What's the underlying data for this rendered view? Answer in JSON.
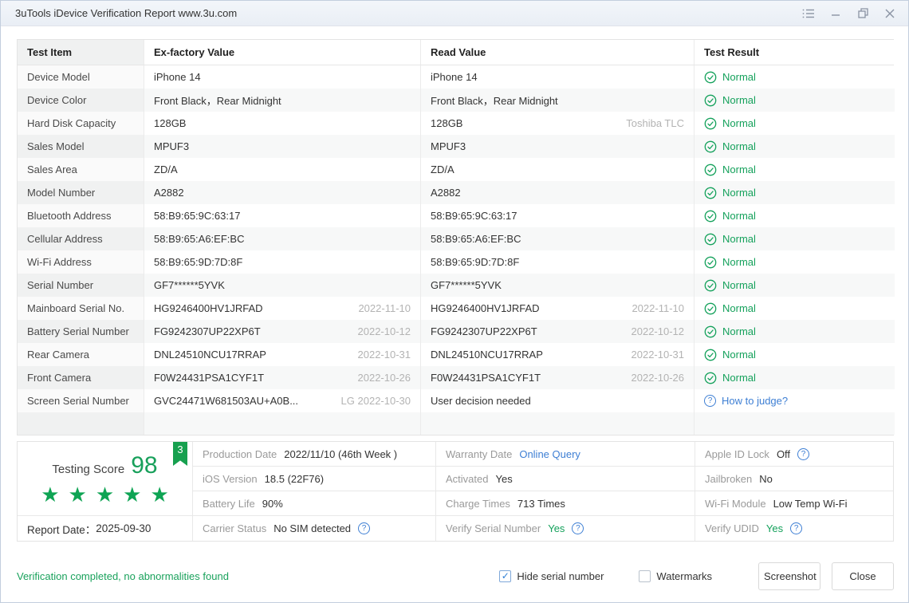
{
  "window": {
    "title": "3uTools iDevice Verification Report www.3u.com"
  },
  "colors": {
    "green": "#14a15b",
    "blue": "#3e7fd4",
    "badge_green": "#17a04f"
  },
  "icons": {
    "check": "✓",
    "question": "?",
    "star": "★"
  },
  "table": {
    "headers": [
      "Test Item",
      "Ex-factory Value",
      "Read Value",
      "Test Result"
    ],
    "rows": [
      {
        "item": "Device Model",
        "ex": "iPhone 14",
        "ex_note": "",
        "read": "iPhone 14",
        "read_note": "",
        "result": "Normal",
        "result_type": "normal"
      },
      {
        "item": "Device Color",
        "ex": "Front Black，Rear Midnight",
        "ex_note": "",
        "read": "Front Black，Rear Midnight",
        "read_note": "",
        "result": "Normal",
        "result_type": "normal"
      },
      {
        "item": "Hard Disk Capacity",
        "ex": "128GB",
        "ex_note": "",
        "read": "128GB",
        "read_note": "Toshiba TLC",
        "result": "Normal",
        "result_type": "normal"
      },
      {
        "item": "Sales Model",
        "ex": "MPUF3",
        "ex_note": "",
        "read": "MPUF3",
        "read_note": "",
        "result": "Normal",
        "result_type": "normal"
      },
      {
        "item": "Sales Area",
        "ex": "ZD/A",
        "ex_note": "",
        "read": "ZD/A",
        "read_note": "",
        "result": "Normal",
        "result_type": "normal"
      },
      {
        "item": "Model Number",
        "ex": "A2882",
        "ex_note": "",
        "read": "A2882",
        "read_note": "",
        "result": "Normal",
        "result_type": "normal"
      },
      {
        "item": "Bluetooth Address",
        "ex": "58:B9:65:9C:63:17",
        "ex_note": "",
        "read": "58:B9:65:9C:63:17",
        "read_note": "",
        "result": "Normal",
        "result_type": "normal"
      },
      {
        "item": "Cellular Address",
        "ex": "58:B9:65:A6:EF:BC",
        "ex_note": "",
        "read": "58:B9:65:A6:EF:BC",
        "read_note": "",
        "result": "Normal",
        "result_type": "normal"
      },
      {
        "item": "Wi-Fi Address",
        "ex": "58:B9:65:9D:7D:8F",
        "ex_note": "",
        "read": "58:B9:65:9D:7D:8F",
        "read_note": "",
        "result": "Normal",
        "result_type": "normal"
      },
      {
        "item": "Serial Number",
        "ex": "GF7******5YVK",
        "ex_note": "",
        "read": "GF7******5YVK",
        "read_note": "",
        "result": "Normal",
        "result_type": "normal"
      },
      {
        "item": "Mainboard Serial No.",
        "ex": "HG9246400HV1JRFAD",
        "ex_note": "2022-11-10",
        "read": "HG9246400HV1JRFAD",
        "read_note": "2022-11-10",
        "result": "Normal",
        "result_type": "normal"
      },
      {
        "item": "Battery Serial Number",
        "ex": "FG9242307UP22XP6T",
        "ex_note": "2022-10-12",
        "read": "FG9242307UP22XP6T",
        "read_note": "2022-10-12",
        "result": "Normal",
        "result_type": "normal"
      },
      {
        "item": "Rear Camera",
        "ex": "DNL24510NCU17RRAP",
        "ex_note": "2022-10-31",
        "read": "DNL24510NCU17RRAP",
        "read_note": "2022-10-31",
        "result": "Normal",
        "result_type": "normal"
      },
      {
        "item": "Front Camera",
        "ex": "F0W24431PSA1CYF1T",
        "ex_note": "2022-10-26",
        "read": "F0W24431PSA1CYF1T",
        "read_note": "2022-10-26",
        "result": "Normal",
        "result_type": "normal"
      },
      {
        "item": "Screen Serial Number",
        "ex": "GVC24471W681503AU+A0B...",
        "ex_note": "LG 2022-10-30",
        "read": "User decision needed",
        "read_note": "",
        "result": "How to judge?",
        "result_type": "question"
      },
      {
        "item": "",
        "ex": "",
        "ex_note": "",
        "read": "",
        "read_note": "",
        "result": "",
        "result_type": "empty"
      }
    ]
  },
  "summary": {
    "score_label": "Testing Score",
    "score": "98",
    "badge": "3",
    "stars": 5,
    "report_date_label": "Report Date：",
    "report_date": "2025-09-30",
    "cells": [
      {
        "label": "Production Date",
        "value": "2022/11/10 (46th Week )",
        "style": "dark",
        "help": false
      },
      {
        "label": "Warranty Date",
        "value": "Online Query",
        "style": "link",
        "help": false
      },
      {
        "label": "Apple ID Lock",
        "value": "Off",
        "style": "dark",
        "help": true
      },
      {
        "label": "iOS Version",
        "value": "18.5 (22F76)",
        "style": "dark",
        "help": false
      },
      {
        "label": "Activated",
        "value": "Yes",
        "style": "dark",
        "help": false
      },
      {
        "label": "Jailbroken",
        "value": "No",
        "style": "dark",
        "help": false
      },
      {
        "label": "Battery Life",
        "value": "90%",
        "style": "dark",
        "help": false
      },
      {
        "label": "Charge Times",
        "value": "713 Times",
        "style": "dark",
        "help": false
      },
      {
        "label": "Wi-Fi Module",
        "value": "Low Temp Wi-Fi",
        "style": "dark",
        "help": false
      },
      {
        "label": "Carrier Status",
        "value": "No SIM detected",
        "style": "dark",
        "help": true
      },
      {
        "label": "Verify Serial Number",
        "value": "Yes",
        "style": "green",
        "help": true
      },
      {
        "label": "Verify UDID",
        "value": "Yes",
        "style": "green",
        "help": true
      }
    ]
  },
  "footer": {
    "status": "Verification completed, no abnormalities found",
    "checkboxes": [
      {
        "label": "Hide serial number",
        "checked": true
      },
      {
        "label": "Watermarks",
        "checked": false
      }
    ],
    "buttons": [
      {
        "label": "Screenshot"
      },
      {
        "label": "Close"
      }
    ]
  }
}
